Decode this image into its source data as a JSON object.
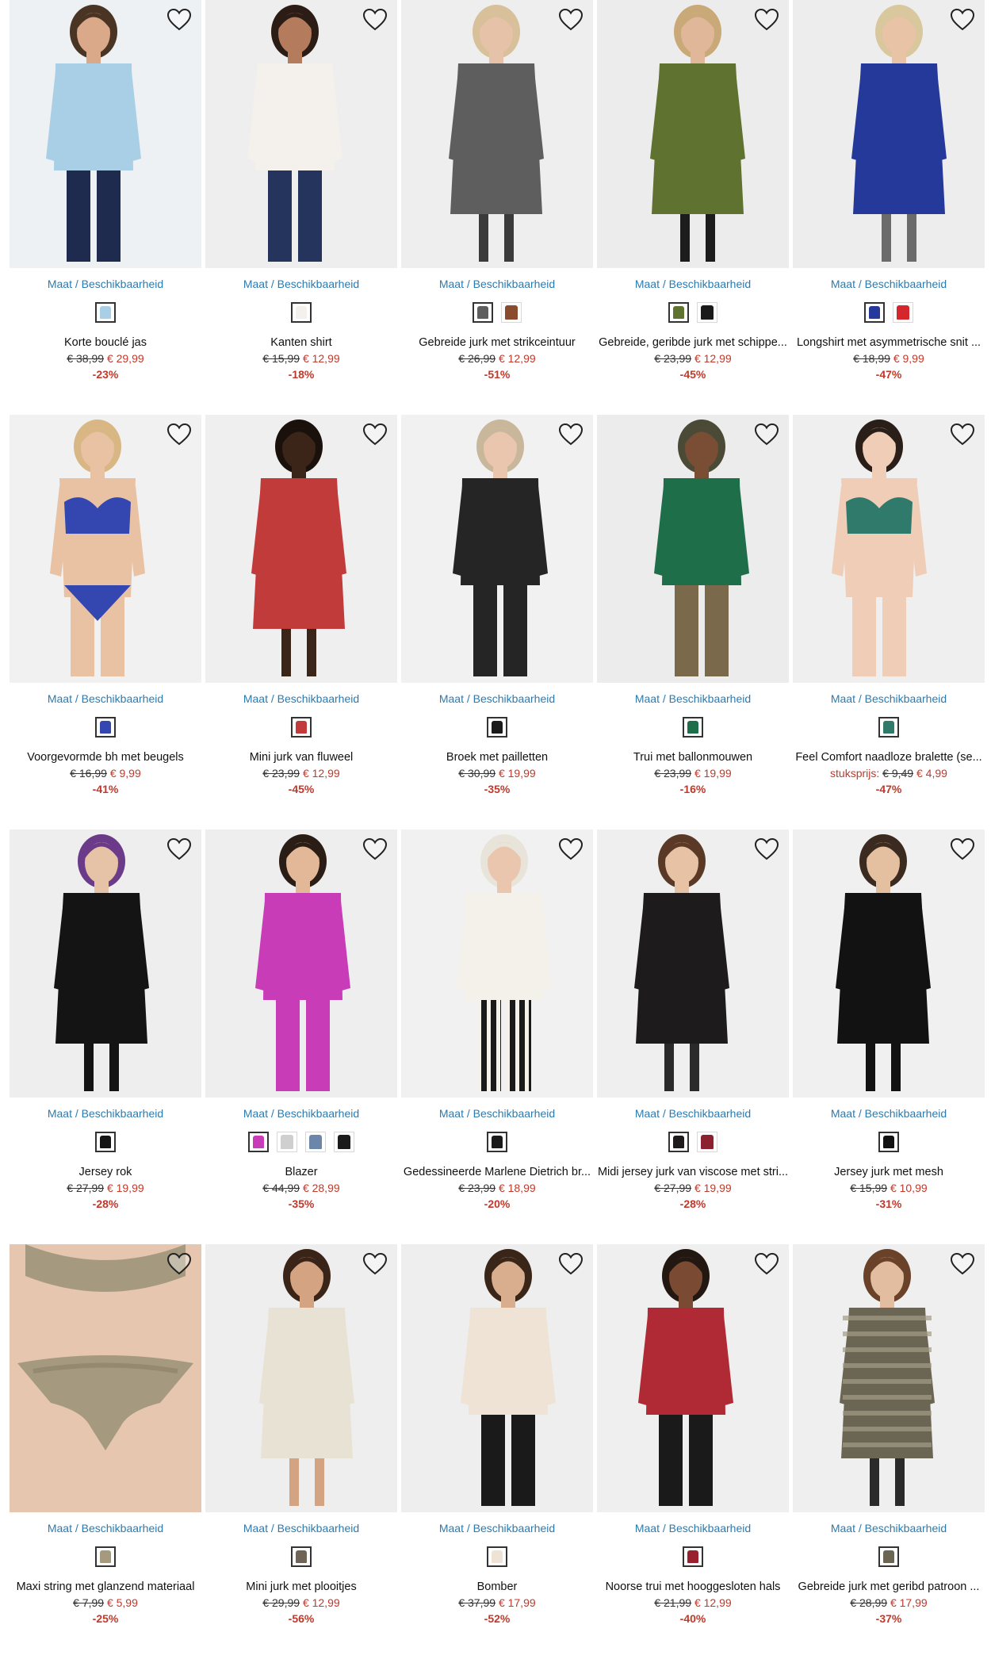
{
  "size_label": "Maat / Beschikbaarheid",
  "products": [
    {
      "name": "Korte bouclé jas",
      "old": "€ 38,99",
      "new": "€ 29,99",
      "pre": "",
      "disc": "-23%",
      "img": "model-light-blue-jacket",
      "bg": "#eef1f4",
      "main": "#a9cfe6",
      "skin": "#d9a98a",
      "hair": "#4a3424",
      "legs": "#1f2a4f",
      "swatches": [
        "#a9cfe6"
      ]
    },
    {
      "name": "Kanten shirt",
      "old": "€ 15,99",
      "new": "€ 12,99",
      "pre": "",
      "disc": "-18%",
      "img": "model-white-lace-shirt",
      "bg": "#eeeeee",
      "main": "#f4f1ec",
      "skin": "#b57b5d",
      "hair": "#2b1d15",
      "legs": "#24345c",
      "swatches": [
        "#f4f1ec"
      ]
    },
    {
      "name": "Gebreide jurk met strikceintuur",
      "old": "€ 26,99",
      "new": "€ 12,99",
      "pre": "",
      "disc": "-51%",
      "img": "model-grey-knit-dress",
      "bg": "#eeeeee",
      "main": "#5e5e5e",
      "skin": "#e5c2a8",
      "hair": "#d7c09a",
      "legs": "#3b3b3b",
      "swatches": [
        "#5e5e5e",
        "#8a4b2e"
      ]
    },
    {
      "name": "Gebreide, geribde jurk met schippe...",
      "old": "€ 23,99",
      "new": "€ 12,99",
      "pre": "",
      "disc": "-45%",
      "img": "model-green-ribbed-dress",
      "bg": "#ececec",
      "main": "#5f7230",
      "skin": "#e0b899",
      "hair": "#caa978",
      "legs": "#1c1c1c",
      "swatches": [
        "#5f7230",
        "#1a1a1a"
      ]
    },
    {
      "name": "Longshirt met asymmetrische snit ...",
      "old": "€ 18,99",
      "new": "€ 9,99",
      "pre": "",
      "disc": "-47%",
      "img": "model-blue-longshirt",
      "bg": "#ededed",
      "main": "#25399a",
      "skin": "#e8c3a6",
      "hair": "#d9c79e",
      "legs": "#6b6b6b",
      "swatches": [
        "#25399a",
        "#d4262b"
      ]
    },
    {
      "name": "Voorgevormde bh met beugels",
      "old": "€ 16,99",
      "new": "€ 9,99",
      "pre": "",
      "disc": "-41%",
      "img": "model-blue-lingerie",
      "bg": "#f1f1f1",
      "main": "#3446b0",
      "skin": "#e9c1a3",
      "hair": "#d8b785",
      "legs": "#e9c1a3",
      "swatches": [
        "#3446b0"
      ]
    },
    {
      "name": "Mini jurk van fluweel",
      "old": "€ 23,99",
      "new": "€ 12,99",
      "pre": "",
      "disc": "-45%",
      "img": "model-red-floral-dress",
      "bg": "#efefef",
      "main": "#c23b3b",
      "skin": "#3b2418",
      "hair": "#1a110c",
      "legs": "#3b2418",
      "swatches": [
        "#c23b3b"
      ]
    },
    {
      "name": "Broek met pailletten",
      "old": "€ 30,99",
      "new": "€ 19,99",
      "pre": "",
      "disc": "-35%",
      "img": "model-sequin-trousers",
      "bg": "#f1f1f1",
      "main": "#252525",
      "skin": "#e9c6ad",
      "hair": "#c9b79b",
      "legs": "#252525",
      "swatches": [
        "#1a1a1a"
      ]
    },
    {
      "name": "Trui met ballonmouwen",
      "old": "€ 23,99",
      "new": "€ 19,99",
      "pre": "",
      "disc": "-16%",
      "img": "model-green-sweater",
      "bg": "#ececec",
      "main": "#1f6e4a",
      "skin": "#7a4e35",
      "hair": "#4b4a36",
      "legs": "#7a6a4b",
      "swatches": [
        "#1f6e4a"
      ]
    },
    {
      "name": "Feel Comfort naadloze bralette (se...",
      "old": "€ 9,49",
      "new": "€ 4,99",
      "pre": "stuksprijs: ",
      "disc": "-47%",
      "img": "model-green-bralette",
      "bg": "#efefef",
      "main": "#2f7a6a",
      "skin": "#f0cdb6",
      "hair": "#2a1f18",
      "legs": "#f0cdb6",
      "swatches": [
        "#2f7a6a"
      ]
    },
    {
      "name": "Jersey rok",
      "old": "€ 27,99",
      "new": "€ 19,99",
      "pre": "",
      "disc": "-28%",
      "img": "model-black-skirt",
      "bg": "#eeeeee",
      "main": "#141414",
      "skin": "#e6c3a6",
      "hair": "#6b3b8a",
      "legs": "#141414",
      "swatches": [
        "#141414"
      ]
    },
    {
      "name": "Blazer",
      "old": "€ 44,99",
      "new": "€ 28,99",
      "pre": "",
      "disc": "-35%",
      "img": "model-pink-blazer",
      "bg": "#eeeeee",
      "main": "#c93cb8",
      "skin": "#e3b898",
      "hair": "#2a1d16",
      "legs": "#c93cb8",
      "swatches": [
        "#c93cb8",
        "#cfcfcf",
        "#6b86a8",
        "#1a1a1a"
      ]
    },
    {
      "name": "Gedessineerde Marlene Dietrich br...",
      "old": "€ 23,99",
      "new": "€ 18,99",
      "pre": "",
      "disc": "-20%",
      "img": "model-striped-trousers",
      "bg": "#f1f1f1",
      "main": "#f3f1ea",
      "skin": "#e9c6ad",
      "hair": "#e8e4da",
      "legs": "#1a1a1a",
      "swatches": [
        "#1a1a1a"
      ]
    },
    {
      "name": "Midi jersey jurk van viscose met stri...",
      "old": "€ 27,99",
      "new": "€ 19,99",
      "pre": "",
      "disc": "-28%",
      "img": "model-black-floral-dress",
      "bg": "#efefef",
      "main": "#1d1b1b",
      "skin": "#e7c2a5",
      "hair": "#5a3a26",
      "legs": "#2a2a2a",
      "swatches": [
        "#1d1b1b",
        "#8a2030"
      ]
    },
    {
      "name": "Jersey jurk met mesh",
      "old": "€ 15,99",
      "new": "€ 10,99",
      "pre": "",
      "disc": "-31%",
      "img": "model-black-mesh-dress",
      "bg": "#f0f0f0",
      "main": "#121212",
      "skin": "#e4bfa0",
      "hair": "#3a2a20",
      "legs": "#121212",
      "swatches": [
        "#121212"
      ]
    },
    {
      "name": "Maxi string met glanzend materiaal",
      "old": "€ 7,99",
      "new": "€ 5,99",
      "pre": "",
      "disc": "-25%",
      "img": "model-taupe-string",
      "bg": "#efe9e4",
      "main": "#a59a80",
      "skin": "#e6c6ae",
      "hair": "#e6c6ae",
      "legs": "#e6c6ae",
      "swatches": [
        "#a59a80"
      ]
    },
    {
      "name": "Mini jurk met plooitjes",
      "old": "€ 29,99",
      "new": "€ 12,99",
      "pre": "",
      "disc": "-56%",
      "img": "model-ikat-print-dress",
      "bg": "#eeeeee",
      "main": "#e8e2d4",
      "skin": "#d4a482",
      "hair": "#3a2418",
      "legs": "#d4a482",
      "swatches": [
        "#6e6556"
      ]
    },
    {
      "name": "Bomber",
      "old": "€ 37,99",
      "new": "€ 17,99",
      "pre": "",
      "disc": "-52%",
      "img": "model-cream-bomber",
      "bg": "#eeeeee",
      "main": "#efe3d6",
      "skin": "#d9ae8e",
      "hair": "#3a2618",
      "legs": "#1a1a1a",
      "swatches": [
        "#efe3d6"
      ]
    },
    {
      "name": "Noorse trui met hooggesloten hals",
      "old": "€ 21,99",
      "new": "€ 12,99",
      "pre": "",
      "disc": "-40%",
      "img": "model-nordic-sweater",
      "bg": "#efefef",
      "main": "#b02a35",
      "skin": "#7a4a32",
      "hair": "#231711",
      "legs": "#1a1a1a",
      "swatches": [
        "#9a2030"
      ]
    },
    {
      "name": "Gebreide jurk met geribd patroon ...",
      "old": "€ 28,99",
      "new": "€ 17,99",
      "pre": "",
      "disc": "-37%",
      "img": "model-knit-striped-dress",
      "bg": "#efefef",
      "main": "#6b6553",
      "skin": "#e3bd9f",
      "hair": "#6a4129",
      "legs": "#2a2a2a",
      "swatches": [
        "#6b6553"
      ]
    }
  ]
}
